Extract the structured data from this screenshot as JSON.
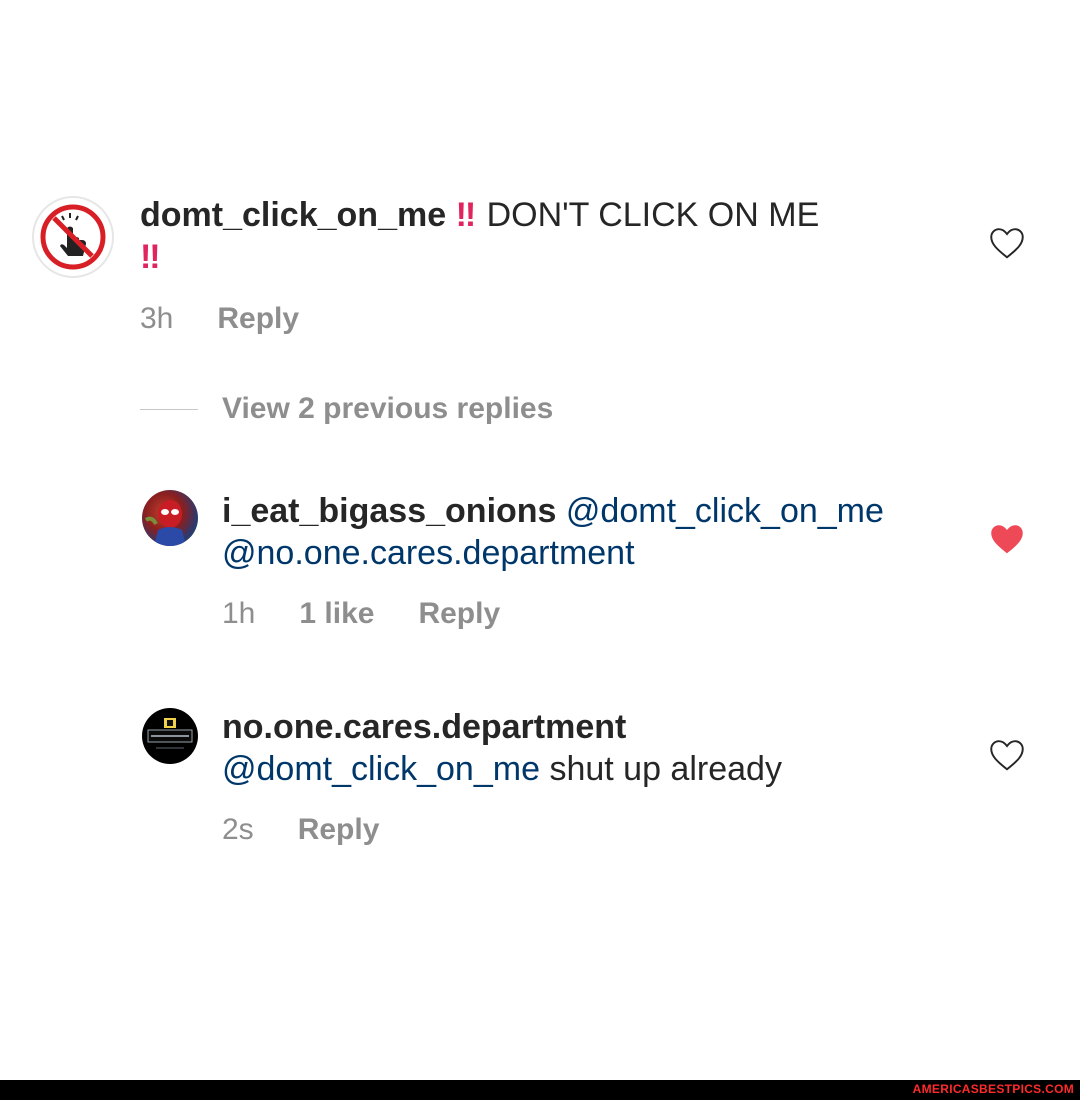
{
  "comments": [
    {
      "username": "domt_click_on_me",
      "bang": "‼",
      "text": "DON'T CLICK ON ME",
      "bang2": "‼",
      "time": "3h",
      "reply_label": "Reply",
      "liked": false,
      "avatar_icon": "no-touch-icon"
    },
    {
      "username": "i_eat_bigass_onions",
      "mention1": "@domt_click_on_me",
      "mention2": "@no.one.cares.department",
      "time": "1h",
      "likes": "1 like",
      "reply_label": "Reply",
      "liked": true,
      "avatar_icon": "spiderman-avatar"
    },
    {
      "username": "no.one.cares.department",
      "mention": "@domt_click_on_me",
      "text": "shut up already",
      "time": "2s",
      "reply_label": "Reply",
      "liked": false,
      "avatar_icon": "department-badge-avatar"
    }
  ],
  "view_replies": "View 2 previous replies",
  "footer": {
    "watermark": "AMERICASBESTPICS.COM"
  },
  "colors": {
    "heart_liked": "#ed4956",
    "mention": "#00376b",
    "meta": "#8e8e8e"
  }
}
